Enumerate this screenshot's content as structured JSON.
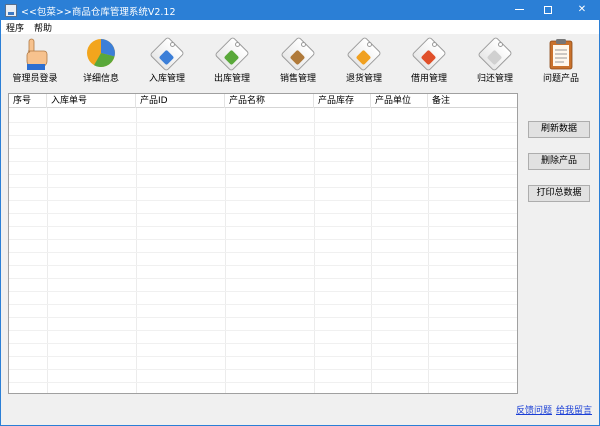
{
  "window": {
    "title": "<<包菜>>商品仓库管理系统V2.12",
    "controls": {
      "minimize": "—",
      "close": "✕"
    }
  },
  "menu": {
    "items": [
      "程序",
      "帮助"
    ]
  },
  "toolbar": {
    "items": [
      {
        "label": "管理员登录",
        "icon": "hand-pointer-icon"
      },
      {
        "label": "详细信息",
        "icon": "pie-chart-icon"
      },
      {
        "label": "入库管理",
        "icon": "tag-icon",
        "color": "#3c7fd8"
      },
      {
        "label": "出库管理",
        "icon": "tag-icon",
        "color": "#59a83a"
      },
      {
        "label": "销售管理",
        "icon": "tag-icon",
        "color": "#b07a3a"
      },
      {
        "label": "退货管理",
        "icon": "tag-icon",
        "color": "#f0a020"
      },
      {
        "label": "借用管理",
        "icon": "tag-icon",
        "color": "#e0502a"
      },
      {
        "label": "归还管理",
        "icon": "tag-icon",
        "color": "#d0d0d0"
      },
      {
        "label": "问题产品",
        "icon": "clipboard-icon"
      }
    ]
  },
  "table": {
    "columns": [
      "序号",
      "入库单号",
      "产品ID",
      "产品名称",
      "产品库存",
      "产品单位",
      "备注"
    ],
    "rows": []
  },
  "actions": {
    "refresh": "刷新数据",
    "delete": "删除产品",
    "print": "打印总数据"
  },
  "footer": {
    "feedback": "反馈问题",
    "message": "给我留言"
  },
  "colors": {
    "titlebar": "#2b7fd6",
    "link": "#1a3fd6"
  }
}
